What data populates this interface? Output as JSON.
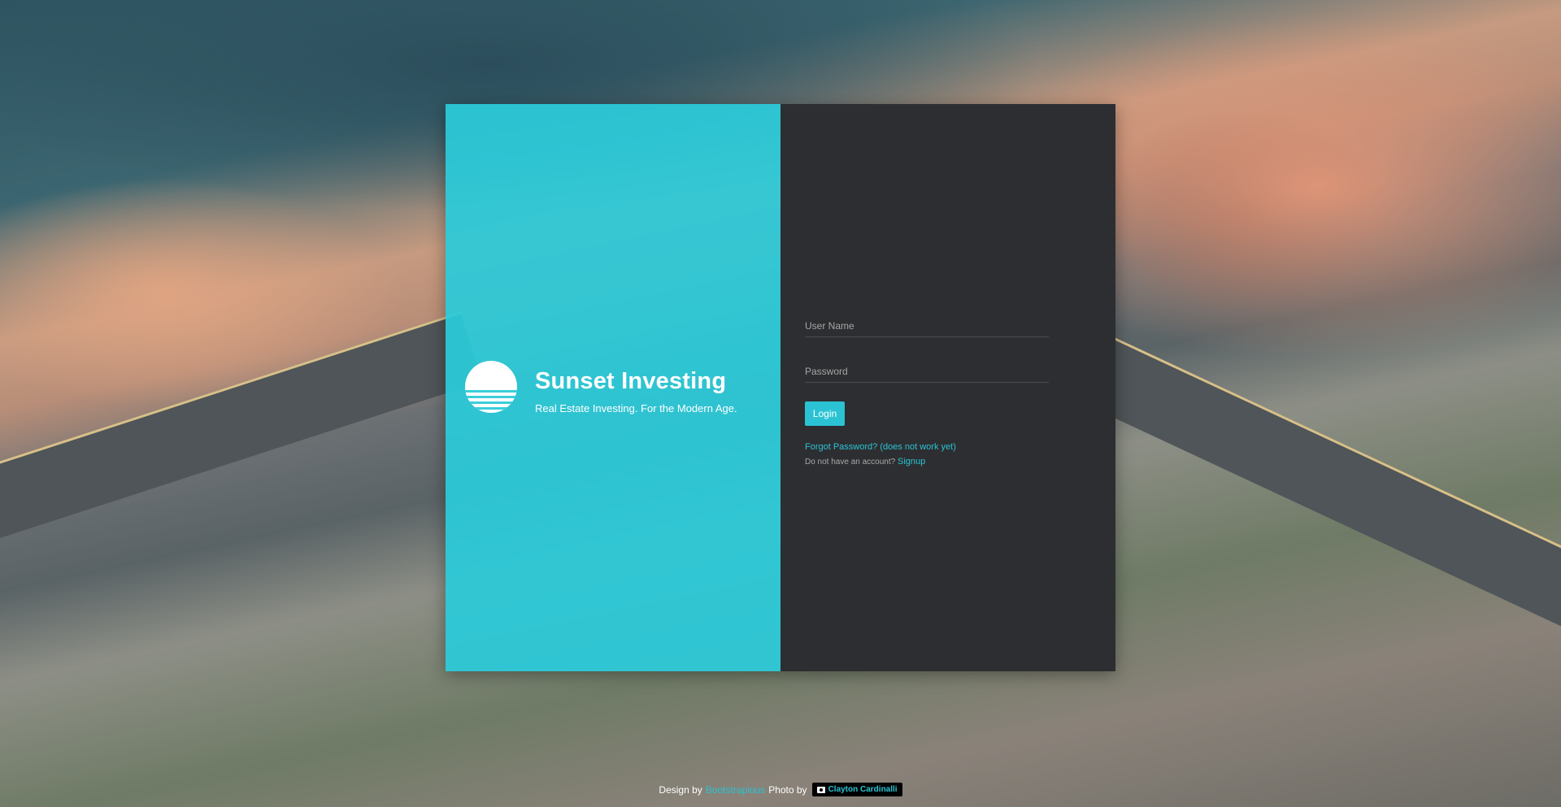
{
  "brand": {
    "title": "Sunset Investing",
    "tagline": "Real Estate Investing. For the Modern Age.",
    "logo_icon": "sunset-logo-icon"
  },
  "login_form": {
    "username_placeholder": "User Name",
    "username_value": "",
    "password_placeholder": "Password",
    "password_value": "",
    "login_label": "Login",
    "forgot_label": "Forgot Password? (does not work yet)",
    "no_account_text": "Do not have an account?",
    "signup_label": "Signup"
  },
  "footer": {
    "design_by": "Design by",
    "design_link": "Bootstrapious",
    "photo_by": "Photo by",
    "photographer": "Clayton Cardinalli",
    "camera_icon": "camera-icon"
  },
  "colors": {
    "accent": "#2bc3d4",
    "panel_left": "#2bcad9",
    "panel_right": "#2d2e31"
  }
}
